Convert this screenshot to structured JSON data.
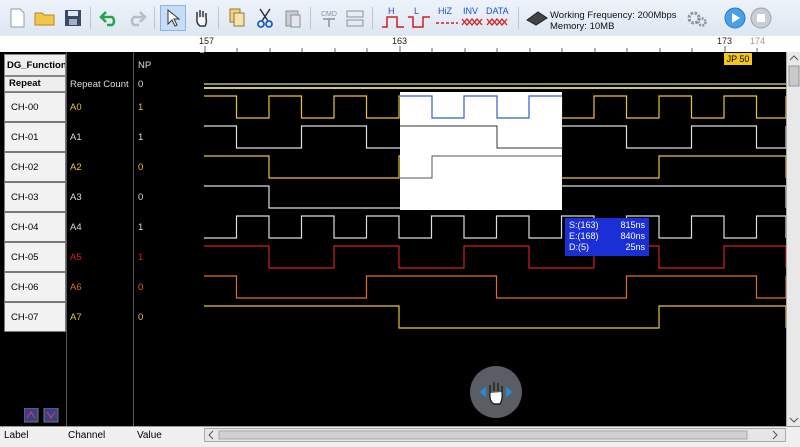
{
  "toolbar": {
    "status_frequency": "Working Frequency: 200Mbps",
    "status_memory": "Memory: 10MB",
    "btn_cmd": "CMD",
    "btn_h": "H",
    "btn_l": "L",
    "btn_hiz": "HiZ",
    "btn_inv": "INV",
    "btn_data": "DATA"
  },
  "ruler": {
    "tick1": "157",
    "tick2": "163",
    "tick3": "173",
    "tick4": "174"
  },
  "marker": {
    "label": "JP 50"
  },
  "table": {
    "header_label": "DG_Function",
    "header_value": "NP",
    "repeat_label": "Repeat",
    "repeat_channel": "Repeat Count",
    "repeat_value": "0",
    "rows": [
      {
        "label": "CH-00",
        "channel": "A0",
        "value": "1",
        "color": "#e8c830"
      },
      {
        "label": "CH-01",
        "channel": "A1",
        "value": "1",
        "color": "#dddddd"
      },
      {
        "label": "CH-02",
        "channel": "A2",
        "value": "0",
        "color": "#e8c830"
      },
      {
        "label": "CH-03",
        "channel": "A3",
        "value": "0",
        "color": "#dddddd"
      },
      {
        "label": "CH-04",
        "channel": "A4",
        "value": "1",
        "color": "#dddddd"
      },
      {
        "label": "CH-05",
        "channel": "A5",
        "value": "1",
        "color": "#d02020"
      },
      {
        "label": "CH-06",
        "channel": "A6",
        "value": "0",
        "color": "#e07020"
      },
      {
        "label": "CH-07",
        "channel": "A7",
        "value": "0",
        "color": "#e8c830"
      }
    ]
  },
  "info": {
    "s_label": "S:(163)",
    "s_val": "815ns",
    "e_label": "E:(168)",
    "e_val": "840ns",
    "d_label": "D:(5)",
    "d_val": "25ns"
  },
  "bottom": {
    "label": "Label",
    "channel": "Channel",
    "value": "Value"
  },
  "colors": {
    "wave_white": "#dddddd",
    "wave_yellow": "#e8c830",
    "wave_red": "#d02020",
    "wave_orange": "#e07020",
    "selection": "#ffffff",
    "info_bg": "#1a2fd6"
  }
}
